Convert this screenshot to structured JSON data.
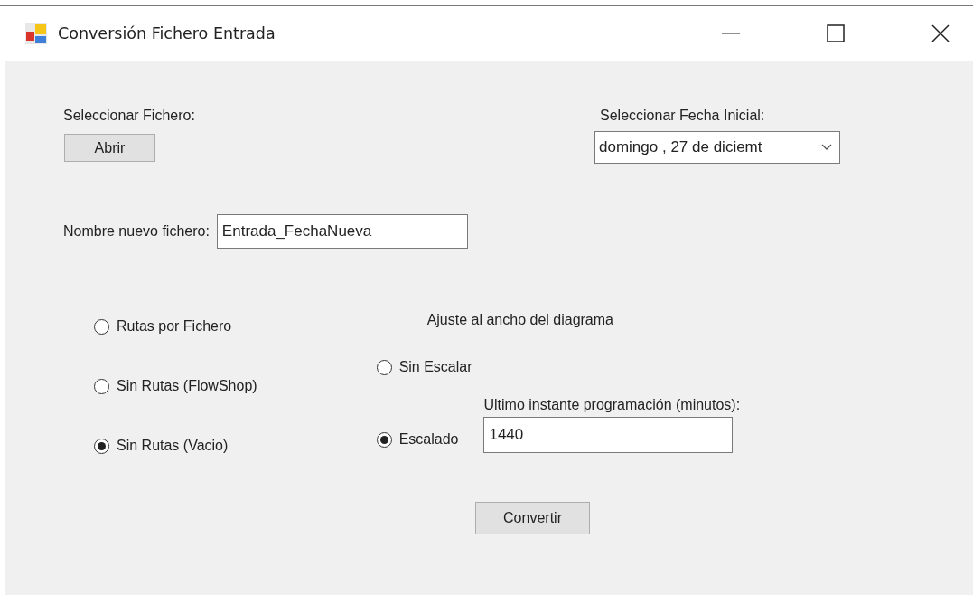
{
  "window": {
    "title": "Conversión Fichero Entrada"
  },
  "file": {
    "label": "Seleccionar Fichero:",
    "button": "Abrir"
  },
  "date": {
    "label": "Seleccionar Fecha Inicial:",
    "value": "domingo , 27 de  diciemt"
  },
  "new_name": {
    "label": "Nombre nuevo fichero:",
    "value": "Entrada_FechaNueva"
  },
  "routes": [
    {
      "label": "Rutas por Fichero",
      "selected": false
    },
    {
      "label": "Sin Rutas (FlowShop)",
      "selected": false
    },
    {
      "label": "Sin Rutas (Vacio)",
      "selected": true
    }
  ],
  "scaling": {
    "title": "Ajuste al ancho del diagrama",
    "options": [
      {
        "label": "Sin Escalar",
        "selected": false
      },
      {
        "label": "Escalado",
        "selected": true
      }
    ],
    "last_instant_label": "Ultimo instante programación (minutos):",
    "last_instant_value": "1440"
  },
  "convert_button": "Convertir"
}
